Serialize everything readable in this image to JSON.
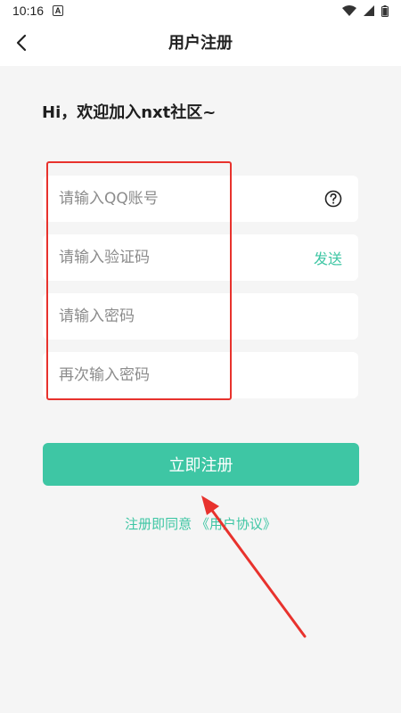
{
  "status_bar": {
    "time": "10:16",
    "notification_icon": "a-icon",
    "icons": [
      "wifi-icon",
      "signal-icon",
      "battery-icon"
    ]
  },
  "header": {
    "title": "用户注册",
    "back_icon": "chevron-left-icon"
  },
  "greeting": "Hi，欢迎加入nxt社区~",
  "form": {
    "qq_placeholder": "请输入QQ账号",
    "code_placeholder": "请输入验证码",
    "send_label": "发送",
    "password_placeholder": "请输入密码",
    "confirm_placeholder": "再次输入密码",
    "help_icon": "question-circle-icon"
  },
  "register_button": "立即注册",
  "agreement": {
    "prefix": "注册即同意 ",
    "link": "《用户协议》"
  },
  "colors": {
    "accent": "#3ec6a4",
    "highlight": "#e8322d",
    "background": "#f5f5f5"
  }
}
